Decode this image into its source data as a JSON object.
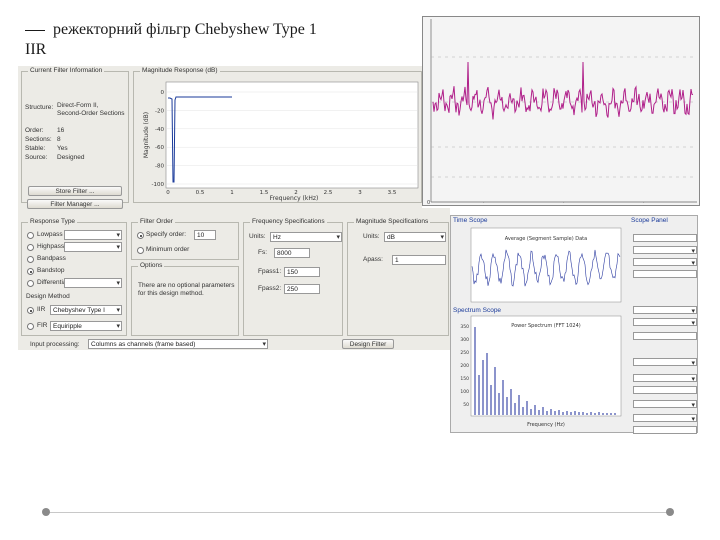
{
  "slide": {
    "title_line1": "режекторний фільгр Chebyshew Type 1",
    "title_line2": "IIR"
  },
  "filter_info": {
    "panel_title": "Current Filter Information",
    "structure_label": "Structure:",
    "structure_value_1": "Direct-Form II,",
    "structure_value_2": "Second-Order Sections",
    "order_label": "Order:",
    "order_value": "16",
    "sections_label": "Sections:",
    "sections_value": "8",
    "stable_label": "Stable:",
    "stable_value": "Yes",
    "source_label": "Source:",
    "source_value": "Designed",
    "store_button": "Store Filter ...",
    "manager_button": "Filter Manager ..."
  },
  "magnitude_plot": {
    "title": "Magnitude Response (dB)",
    "ylabel": "Magnitude (dB)",
    "xlabel": "Frequency (kHz)",
    "y_ticks": [
      "0",
      "-20",
      "-40",
      "-60",
      "-80",
      "-100"
    ],
    "x_ticks": [
      "0",
      "0.5",
      "1",
      "1.5",
      "2",
      "2.5",
      "3",
      "3.5"
    ]
  },
  "response_type": {
    "panel_title": "Response Type",
    "options": [
      "Lowpass",
      "Highpass",
      "Bandpass",
      "Bandstop",
      "Differentiator"
    ],
    "selected": "Bandstop",
    "design_method_title": "Design Method",
    "iir_label": "IIR",
    "iir_value": "Chebyshev Type I",
    "fir_label": "FIR",
    "fir_value": "Equiripple"
  },
  "filter_order": {
    "panel_title": "Filter Order",
    "specify_label": "Specify order:",
    "specify_value": "10",
    "minimum_label": "Minimum order",
    "options_title": "Options",
    "options_text_1": "There are no optional parameters",
    "options_text_2": "for this design method."
  },
  "freq_spec": {
    "panel_title": "Frequency Specifications",
    "units_label": "Units:",
    "units_value": "Hz",
    "fs_label": "Fs:",
    "fs_value": "8000",
    "fpass1_label": "Fpass1:",
    "fpass1_value": "150",
    "fpass2_label": "Fpass2:",
    "fpass2_value": "250"
  },
  "mag_spec": {
    "panel_title": "Magnitude Specifications",
    "units_label": "Units:",
    "units_value": "dB",
    "apass_label": "Apass:",
    "apass_value": "1"
  },
  "bottom_bar": {
    "input_label": "Input processing:",
    "input_value": "Columns as channels (frame based)",
    "design_button": "Design Filter"
  },
  "spectrum": {
    "left_title_1": "Time Scope",
    "left_title_2": "Spectrum Scope",
    "right_title": "Scope Panel",
    "top_plot_title": "Average (Segment Sample) Data",
    "bottom_plot_title": "Power Spectrum (FFT 1024)",
    "bottom_xlabel": "Frequency (Hz)",
    "y_ticks": [
      "350",
      "300",
      "250",
      "200",
      "150",
      "100",
      "50"
    ]
  },
  "colors": {
    "signal": "#b0208a",
    "spectrum_line": "#1a2a9a",
    "gui_bg": "#ecebe6"
  }
}
